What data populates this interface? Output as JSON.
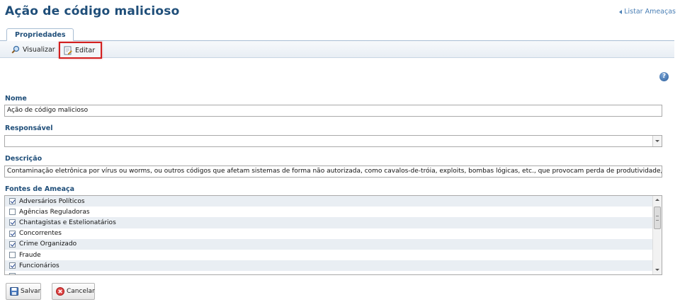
{
  "page": {
    "title": "Ação de código malicioso",
    "back_link": "Listar Ameaças"
  },
  "tabs": [
    {
      "label": "Propriedades",
      "active": true
    }
  ],
  "toolbar": {
    "view_label": "Visualizar",
    "edit_label": "Editar"
  },
  "form": {
    "name_label": "Nome",
    "name_value": "Ação de código malicioso",
    "responsible_label": "Responsável",
    "responsible_value": "",
    "description_label": "Descrição",
    "description_value": "Contaminação eletrônica por vírus ou worms, ou outros códigos que afetam sistemas de forma não autorizada, como cavalos-de-tróia, exploits, bombas lógicas, etc., que provocam perda de produtividade, desconfiança, constrangimento na troca de",
    "sources_label": "Fontes de Ameaça",
    "sources": [
      {
        "label": "Adversários Políticos",
        "checked": true
      },
      {
        "label": "Agências Reguladoras",
        "checked": false
      },
      {
        "label": "Chantagistas e Estelionatários",
        "checked": true
      },
      {
        "label": "Concorrentes",
        "checked": true
      },
      {
        "label": "Crime Organizado",
        "checked": true
      },
      {
        "label": "Fraude",
        "checked": false
      },
      {
        "label": "Funcionários",
        "checked": true
      }
    ]
  },
  "actions": {
    "save_label": "Salvar",
    "cancel_label": "Cancelar"
  },
  "colors": {
    "title": "#1f4e79",
    "link": "#4a7fb5",
    "highlight": "#d32020"
  }
}
